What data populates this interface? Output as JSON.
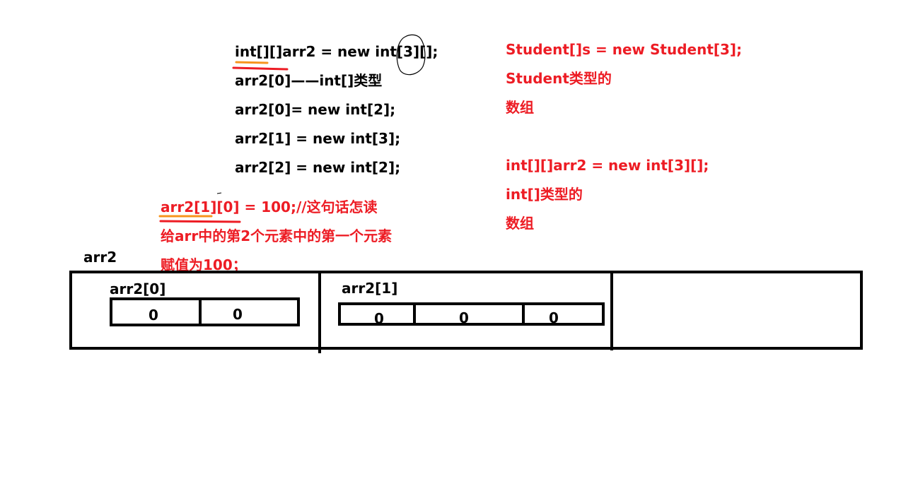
{
  "code_lines": [
    "int[][]arr2 = new int[3][];",
    "arr2[0]——int[]类型",
    "arr2[0]= new int[2];",
    "arr2[1] = new int[3];",
    "arr2[2] = new int[2];"
  ],
  "annotation": {
    "line1": "arr2[1][0] = 100;//这句话怎读",
    "line2": "给arr中的第2个元素中的第一个元素",
    "line3": "赋值为100；"
  },
  "right_notes": [
    "Student[]s = new Student[3];",
    "Student类型的",
    "数组",
    "int[][]arr2 = new int[3][];",
    "int[]类型的",
    "数组"
  ],
  "diagram": {
    "outer_label": "arr2",
    "sub0": {
      "label": "arr2[0]",
      "cells": [
        "0",
        "0"
      ]
    },
    "sub1": {
      "label": "arr2[1]",
      "cells": [
        "0",
        "0",
        "0"
      ]
    }
  },
  "colors": {
    "text": "#000000",
    "highlight": "#ed1c24",
    "underline_orange": "#f7941d"
  }
}
